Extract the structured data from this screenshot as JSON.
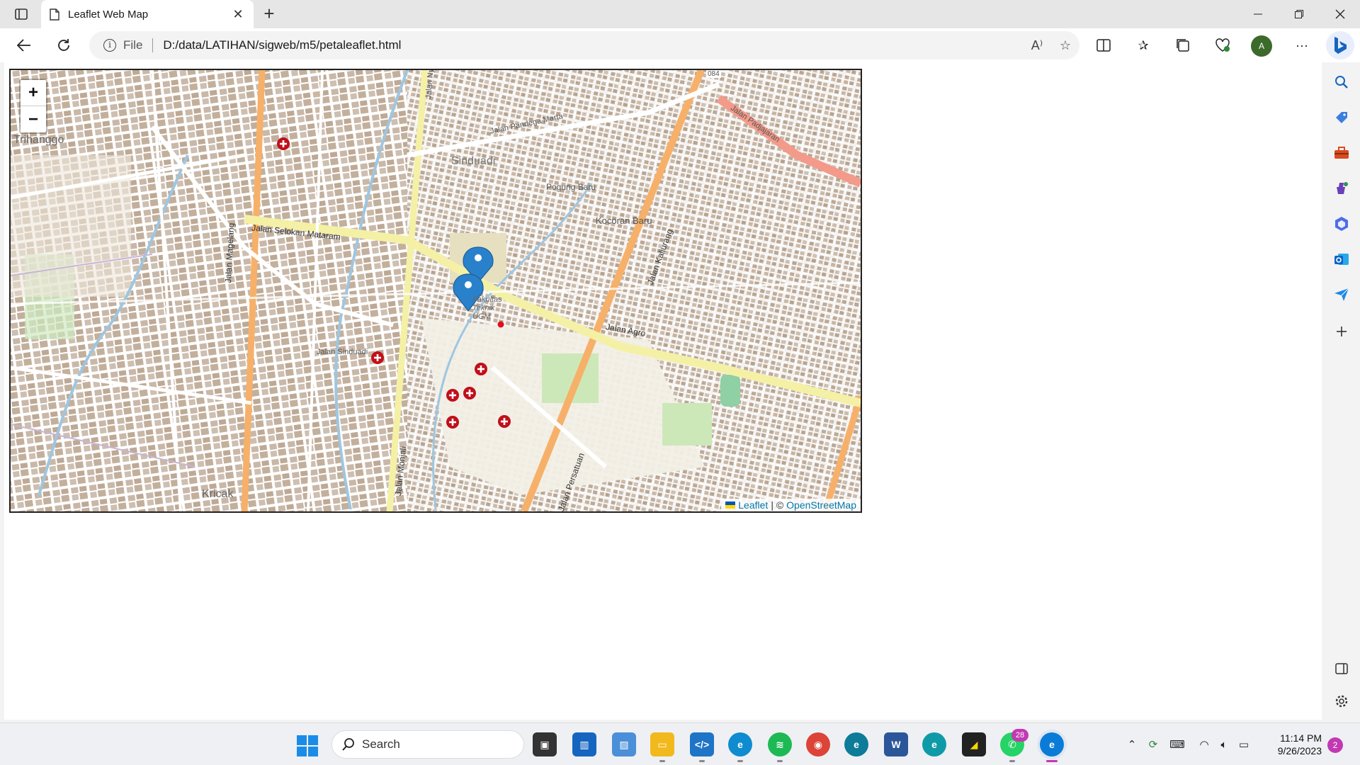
{
  "browser": {
    "tab_title": "Leaflet Web Map",
    "new_tab_label": "+",
    "address_scheme": "File",
    "address_url": "D:/data/LATIHAN/sigweb/m5/petaleaflet.html",
    "profile_initial": "A"
  },
  "map": {
    "zoom_in": "+",
    "zoom_out": "−",
    "attribution_leaflet": "Leaflet",
    "attribution_sep": "| ©",
    "attribution_osm": "OpenStreetMap",
    "labels": {
      "trihanggo": "Trihanggo",
      "sinduadi": "Sinduadi",
      "kricak": "Kricak",
      "kocoran_baru": "Kocoran Baru",
      "pogung_baru": "Pogung Baru",
      "jalan_selokan_mataram": "Jalan Selokan Mataram",
      "jalan_magelang": "Jalan Magelang",
      "jalan_monjali": "Jalan Monjali",
      "jalan_kaliurang": "Jalan Kaliurang",
      "jalan_persatuan": "Jalan Persatuan",
      "jalan_agro": "Jalan Agro",
      "jalan_pandega_marta": "Jalan Pandega Marta",
      "jalan_padjajaran": "Jalan Padjajaran",
      "jalan_sinduadi": "Jalan Sinduadi",
      "fakultas_teknik": "Fakultas Teknik UGM",
      "jalan_nyi_tjondro": "Jalan Nyi Tjondro",
      "road_084": "084"
    },
    "markers_blue": 2,
    "markers_red_cross": 7,
    "markers_red_dot": 1
  },
  "taskbar": {
    "search_label": "Search",
    "whatsapp_badge": "28",
    "time": "11:14 PM",
    "date": "9/26/2023",
    "notifications": "2"
  }
}
